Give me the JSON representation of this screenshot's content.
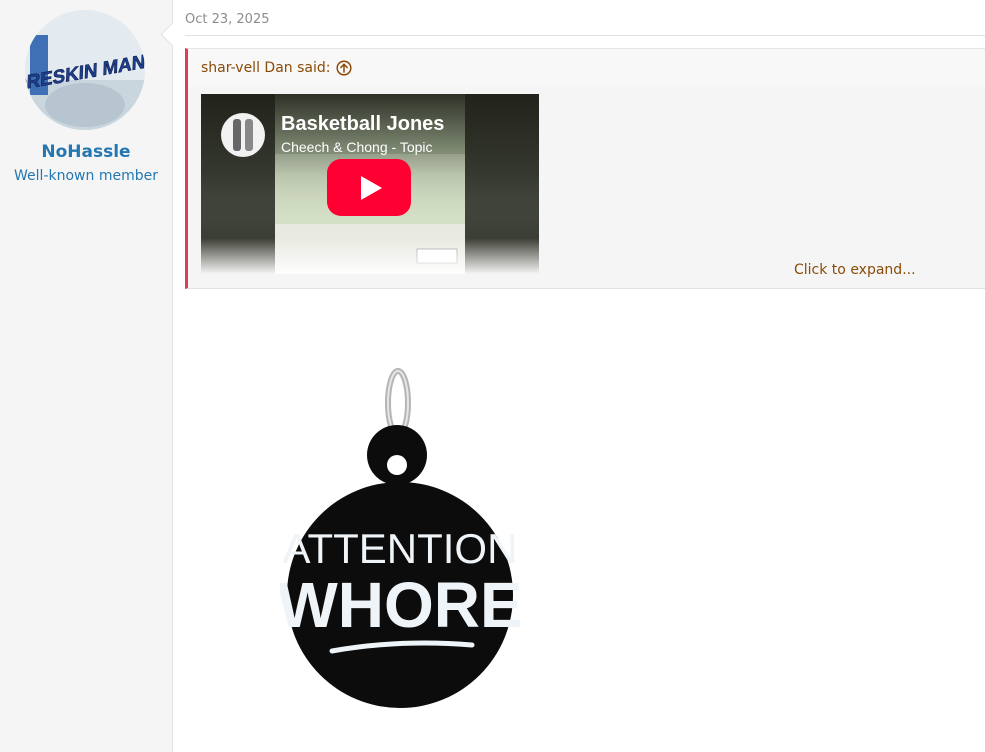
{
  "user": {
    "name": "NoHassle",
    "title": "Well-known member",
    "avatar_text": "FORESKIN MAN"
  },
  "post": {
    "date": "Oct 23, 2025"
  },
  "quote": {
    "attribution": "shar-vell Dan said:",
    "expand_label": "Click to expand...",
    "video": {
      "title": "Basketball Jones",
      "channel": "Cheech & Chong - Topic"
    }
  },
  "image": {
    "line1": "ATTENTION",
    "line2": "WHORE"
  },
  "colors": {
    "link": "#2577b1",
    "quote_accent": "#e03a5d",
    "quote_text": "#8a4b08",
    "youtube_red": "#ff0033"
  }
}
